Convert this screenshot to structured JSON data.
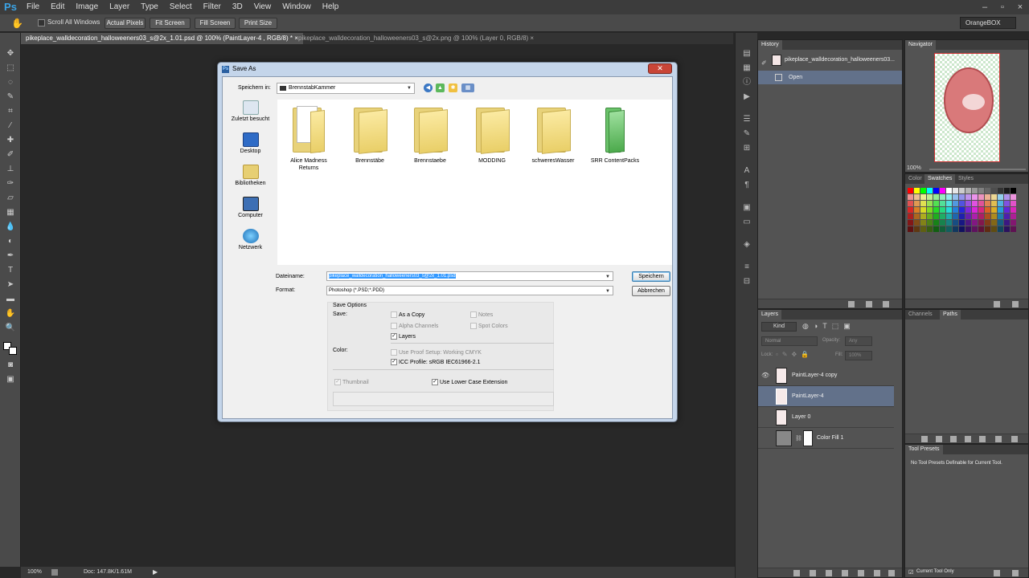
{
  "app": {
    "logo": "Ps"
  },
  "menu": [
    "File",
    "Edit",
    "Image",
    "Layer",
    "Type",
    "Select",
    "Filter",
    "3D",
    "View",
    "Window",
    "Help"
  ],
  "options_bar": {
    "scroll_all_label": "Scroll All Windows",
    "buttons": [
      "Actual Pixels",
      "Fit Screen",
      "Fill Screen",
      "Print Size"
    ],
    "workspace": "OrangeBOX"
  },
  "tabs": [
    {
      "label": "pikeplace_walldecoration_halloweeners03_s@2x_1.01.psd @ 100% (PaintLayer-4  , RGB/8) *",
      "close": "×"
    },
    {
      "label": "pikeplace_walldecoration_halloweeners03_s@2x.png @ 100% (Layer 0, RGB/8)",
      "close": "×"
    }
  ],
  "status": {
    "zoom": "100%",
    "doc": "Doc: 147.8K/1.61M"
  },
  "history": {
    "tab": "History",
    "snapshot": "pikeplace_walldecoration_halloweeners03...",
    "items": [
      "Open"
    ]
  },
  "navigator": {
    "tab": "Navigator",
    "zoom": "100%"
  },
  "swatches_panel": {
    "tabs": [
      "Color",
      "Swatches",
      "Styles"
    ]
  },
  "layers_panel": {
    "tabs": [
      "Layers",
      "Channels",
      "Paths"
    ],
    "filter": "Kind",
    "blend_mode": "Normal",
    "opacity_label": "Opacity:",
    "opacity_value": "Any",
    "lock_label": "Lock:",
    "fill_label": "Fill:",
    "fill_value": "100%",
    "layers": [
      {
        "name": "PaintLayer-4 copy",
        "visible": true,
        "selected": false
      },
      {
        "name": "PaintLayer-4",
        "visible": false,
        "selected": true
      },
      {
        "name": "Layer 0",
        "visible": false,
        "selected": false
      },
      {
        "name": "Color Fill 1",
        "visible": false,
        "selected": false
      }
    ]
  },
  "tool_presets": {
    "tab": "Tool Presets",
    "message": "No Tool Presets Definable for Current Tool.",
    "current_only": "Current Tool Only"
  },
  "dialog": {
    "title": "Save As",
    "close": "✕",
    "save_in_label": "Speichern in:",
    "save_in_value": "BrennstabKammer",
    "places": [
      "Zuletzt besucht",
      "Desktop",
      "Bibliotheken",
      "Computer",
      "Netzwerk"
    ],
    "files": [
      {
        "name": "Alice Madness Returns",
        "kind": "docs"
      },
      {
        "name": "Brennstäbe",
        "kind": "folder"
      },
      {
        "name": "Brennstaebe",
        "kind": "folder"
      },
      {
        "name": "MODDING",
        "kind": "folder"
      },
      {
        "name": "schweresWasser",
        "kind": "folder"
      },
      {
        "name": "SRR ContentPacks",
        "kind": "green"
      }
    ],
    "filename_label": "Dateiname:",
    "filename_value": "pikeplace_walldecoration_halloweeners03_s@2x_1.01.psd",
    "format_label": "Format:",
    "format_value": "Photoshop (*.PSD;*.PDD)",
    "save_button": "Speichern",
    "cancel_button": "Abbrechen",
    "save_options_title": "Save Options",
    "save_label": "Save:",
    "opt_as_copy": "As a Copy",
    "opt_notes": "Notes",
    "opt_alpha": "Alpha Channels",
    "opt_spot": "Spot Colors",
    "opt_layers": "Layers",
    "color_label": "Color:",
    "opt_proof": "Use Proof Setup:  Working CMYK",
    "opt_icc": "ICC Profile:  sRGB IEC61966-2.1",
    "opt_thumbnail": "Thumbnail",
    "opt_lowercase": "Use Lower Case Extension"
  }
}
